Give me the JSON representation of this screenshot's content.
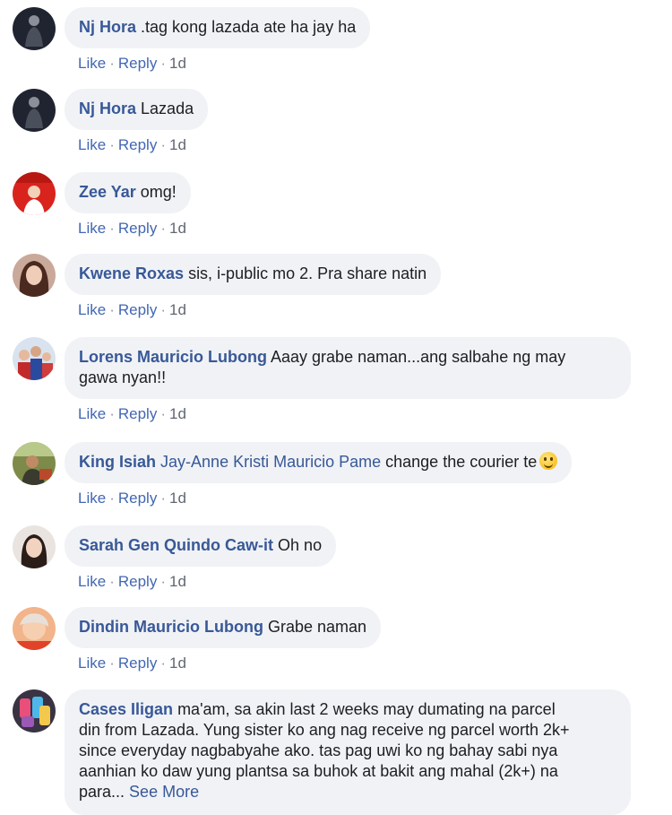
{
  "actions": {
    "like": "Like",
    "reply": "Reply",
    "separator": "·"
  },
  "comments": [
    {
      "author": "Nj Hora",
      "text": ".tag kong lazada ate ha jay ha",
      "time": "1d",
      "avatar_icon": "avatar-dark-figure"
    },
    {
      "author": "Nj Hora",
      "text": "Lazada",
      "time": "1d",
      "avatar_icon": "avatar-dark-figure"
    },
    {
      "author": "Zee Yar",
      "text": "omg!",
      "time": "1d",
      "avatar_icon": "avatar-red"
    },
    {
      "author": "Kwene Roxas",
      "text": "sis, i-public mo 2. Pra share natin",
      "time": "1d",
      "avatar_icon": "avatar-portrait"
    },
    {
      "author": "Lorens Mauricio Lubong",
      "text": "Aaay grabe naman...ang salbahe ng may",
      "text2": "gawa nyan!!",
      "time": "1d",
      "avatar_icon": "avatar-group"
    },
    {
      "author": "King Isiah",
      "tag": "Jay-Anne Kristi Mauricio Pame",
      "text": "change the courier te",
      "emoji": "smiley-emoji",
      "time": "1d",
      "avatar_icon": "avatar-outdoor"
    },
    {
      "author": "Sarah Gen Quindo Caw-it",
      "text": "Oh no",
      "time": "1d",
      "avatar_icon": "avatar-portrait-light"
    },
    {
      "author": "Dindin Mauricio Lubong",
      "text": "Grabe naman",
      "time": "1d",
      "avatar_icon": "avatar-child"
    },
    {
      "author": "Cases Iligan",
      "text": "ma'am, sa akin last 2 weeks may dumating na parcel",
      "text2": "din from Lazada. Yung sister ko ang nag receive ng parcel worth 2k+",
      "text3": "since everyday nagbabyahe ako. tas pag uwi ko ng bahay sabi nya",
      "text4": "aanhian ko daw yung plantsa sa buhok at bakit ang mahal (2k+) na",
      "text5": "para...",
      "see_more": "See More",
      "avatar_icon": "avatar-phone-cases"
    }
  ]
}
